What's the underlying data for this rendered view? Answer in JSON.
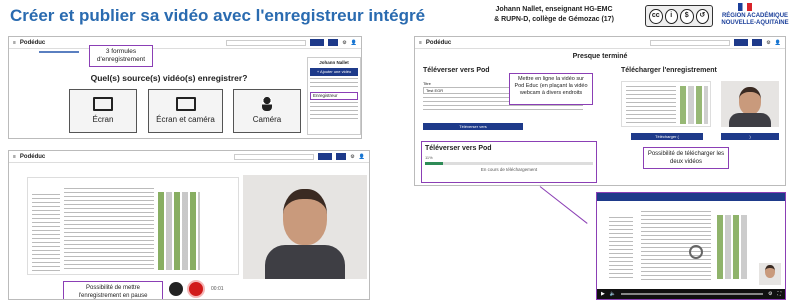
{
  "header": {
    "title": "Créer et publier sa vidéo avec l'enregistreur intégré",
    "credit_line1": "Johann Nallet, enseignant HG-EMC",
    "credit_line2": "& RUPN-D, collège de Gémozac (17)",
    "license_icons": [
      "cc-icon",
      "by-icon",
      "nc-icon",
      "sa-icon"
    ],
    "region_line1": "RÉGION ACADÉMIQUE",
    "region_line2": "NOUVELLE-AQUITAINE"
  },
  "panel1": {
    "logo": "Podéduc",
    "question": "Quel(s) source(s) vidéo(s) enregistrer?",
    "buttons": [
      {
        "label": "Écran",
        "icon": "monitor-icon"
      },
      {
        "label": "Écran et caméra",
        "icon": "screen-camera-icon"
      },
      {
        "label": "Caméra",
        "icon": "person-icon"
      }
    ],
    "callout": "3 formules d'enregistrement",
    "popup_user": "Johann Nallet",
    "popup_button": "+ Ajouter une vidéo",
    "popup_link": "Enregistreur"
  },
  "panel2": {
    "logo": "Podéduc",
    "callout": "Possibilité de mettre l'enregistrement en pause",
    "timer": "00:01"
  },
  "panel3": {
    "logo": "Podéduc",
    "heading": "Presque terminé",
    "left_title": "Téléverser vers Pod",
    "right_title": "Télécharger l'enregistrement",
    "field_label": "Titre",
    "field_value": "Test EGR",
    "upload_button": "Téléverser vers ",
    "callout_webcam": "Mettre en ligne la vidéo sur Pod Educ (en plaçant la vidéo webcam à divers endroits",
    "callout_download": "Possibilité de télécharger les deux vidéos",
    "download_buttons": [
      "Télécharger (",
      ")"
    ],
    "upload_box_title": "Téléverser vers Pod",
    "upload_percent": "11%",
    "upload_status": "En cours de téléchargement",
    "upload_progress": 0.11
  },
  "colors": {
    "title": "#2a6bb0",
    "callout_border": "#8b3fb5",
    "button_blue": "#1e3a8a",
    "record": "#d11a1a"
  }
}
